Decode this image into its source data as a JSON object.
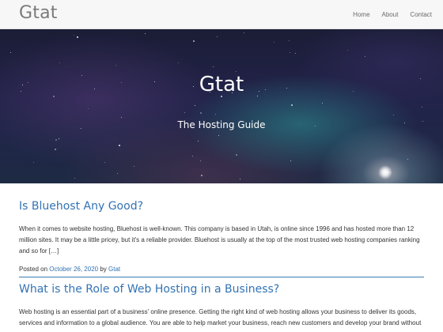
{
  "header": {
    "site_title": "Gtat",
    "nav": [
      {
        "label": "Home"
      },
      {
        "label": "About"
      },
      {
        "label": "Contact"
      }
    ]
  },
  "hero": {
    "title": "Gtat",
    "subtitle": "The Hosting Guide"
  },
  "posts": [
    {
      "title": "Is Bluehost Any Good?",
      "excerpt": "When it comes to website hosting, Bluehost is well-known. This company is based in Utah, is online since 1996 and has hosted more than 12 million sites. It may be a little pricey, but it's a reliable provider. Bluehost is usually at the top of the most trusted web hosting companies ranking and so for […]",
      "meta": {
        "posted_on_label": "Posted on",
        "date": "October 26, 2020",
        "by_label": "by",
        "author": "Gtat"
      }
    },
    {
      "title": "What is the Role of Web Hosting in a Business?",
      "excerpt": "Web hosting is an essential part of a business' online presence. Getting the right kind of web hosting allows your business to deliver its goods, services and information to a global audience. You are able to help market your business, reach new customers and develop your brand without"
    }
  ],
  "colors": {
    "link": "#3273b4",
    "header_bg": "#f7f7f7",
    "hero_bg": "#1d2244",
    "text": "#333333"
  }
}
